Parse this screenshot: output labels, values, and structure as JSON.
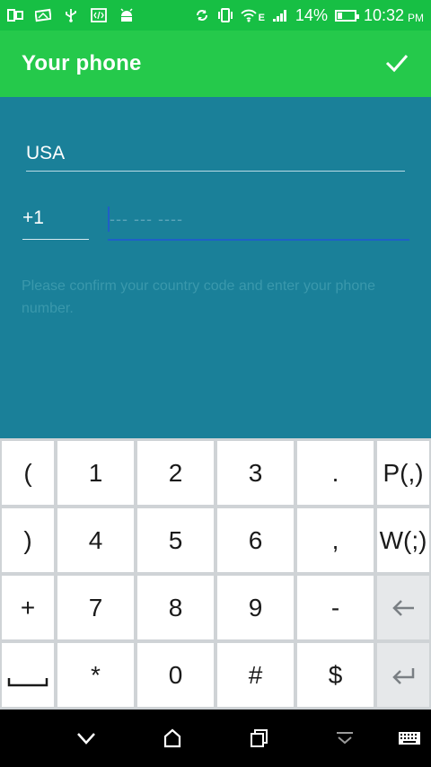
{
  "status_bar": {
    "network_type": "E",
    "battery_percent": "14%",
    "time": "10:32",
    "time_suffix": "PM",
    "icons": [
      "screen-icon",
      "image-icon",
      "usb-icon",
      "code-icon",
      "android-icon",
      "sync-icon",
      "vibrate-icon",
      "wifi-icon",
      "signal-icon",
      "battery-icon"
    ]
  },
  "app_bar": {
    "title": "Your phone",
    "confirm_icon": "check-icon"
  },
  "form": {
    "country": "USA",
    "country_code": "+1",
    "phone_placeholder": "--- --- ----",
    "phone_value": "",
    "hint": "Please confirm your country code and enter your phone number."
  },
  "keyboard": {
    "rows": [
      [
        "(",
        "1",
        "2",
        "3",
        ".",
        "P(,)"
      ],
      [
        ")",
        "4",
        "5",
        "6",
        ",",
        "W(;)"
      ],
      [
        "+",
        "7",
        "8",
        "9",
        "-",
        "backspace"
      ],
      [
        "space",
        "*",
        "0",
        "#",
        "$",
        "enter"
      ]
    ]
  },
  "nav_bar": {
    "icons": [
      "back-icon",
      "home-icon",
      "recents-icon",
      "hide-keyboard-icon",
      "keyboard-icon"
    ]
  },
  "colors": {
    "status_bar": "#17bf44",
    "app_bar": "#25c94b",
    "background": "#1a8099",
    "focus_underline": "#1f5fc7"
  }
}
